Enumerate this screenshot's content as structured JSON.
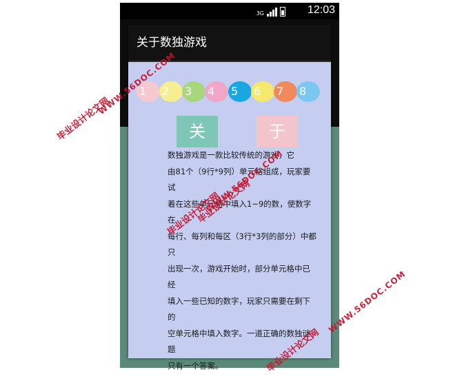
{
  "status_bar": {
    "network": "3G",
    "time": "12:03"
  },
  "dialog": {
    "title": "关于数独游戏",
    "numbers": [
      {
        "label": "1",
        "color": "#f6c9d0"
      },
      {
        "label": "2",
        "color": "#f7ef8f"
      },
      {
        "label": "3",
        "color": "#a7d67d"
      },
      {
        "label": "4",
        "color": "#f2a6c7"
      },
      {
        "label": "5",
        "color": "#18a7e0"
      },
      {
        "label": "6",
        "color": "#f4e96c"
      },
      {
        "label": "7",
        "color": "#f08a5d"
      },
      {
        "label": "8",
        "color": "#7cc7ef"
      }
    ],
    "tiles": [
      {
        "label": "关",
        "color": "#7ec7b6"
      },
      {
        "label": "于",
        "color": "#f2c5cd"
      }
    ],
    "about_text": "数独游戏是一款比较传统的游戏，它\n由81个（9行*9列）单元格组成，玩家要试\n着在这些单元格中填入1~9的数，使数字在\n每行、每列和每区（3行*3列的部分）中都只\n出现一次，游戏开始时，部分单元格中已经\n填入一些已知的数字，玩家只需要在剩下的\n空单元格中填入数字。一道正确的数独谜题\n只有一个答案。"
  },
  "watermarks": {
    "cn": "毕业设计论文网",
    "url": "WWW.56DOC.COM"
  }
}
